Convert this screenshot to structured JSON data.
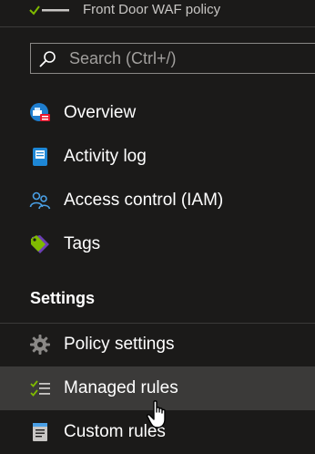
{
  "header": {
    "subtitle": "Front Door WAF policy",
    "policy_icon": "waf-policy-icon"
  },
  "search": {
    "placeholder": "Search (Ctrl+/)",
    "value": "",
    "icon": "search-icon"
  },
  "nav": {
    "items": [
      {
        "label": "Overview",
        "icon": "overview-icon"
      },
      {
        "label": "Activity log",
        "icon": "activity-log-icon"
      },
      {
        "label": "Access control (IAM)",
        "icon": "people-icon"
      },
      {
        "label": "Tags",
        "icon": "tag-icon"
      }
    ]
  },
  "settings": {
    "heading": "Settings",
    "items": [
      {
        "label": "Policy settings",
        "icon": "gear-icon"
      },
      {
        "label": "Managed rules",
        "icon": "managed-rules-icon",
        "active": true
      },
      {
        "label": "Custom rules",
        "icon": "custom-rules-icon"
      }
    ]
  },
  "colors": {
    "background": "#1b1a19",
    "active_row": "#3b3a39",
    "text": "#ffffff",
    "muted_text": "#c8c6c4",
    "border": "#8a8886",
    "check_green": "#7fba00"
  }
}
